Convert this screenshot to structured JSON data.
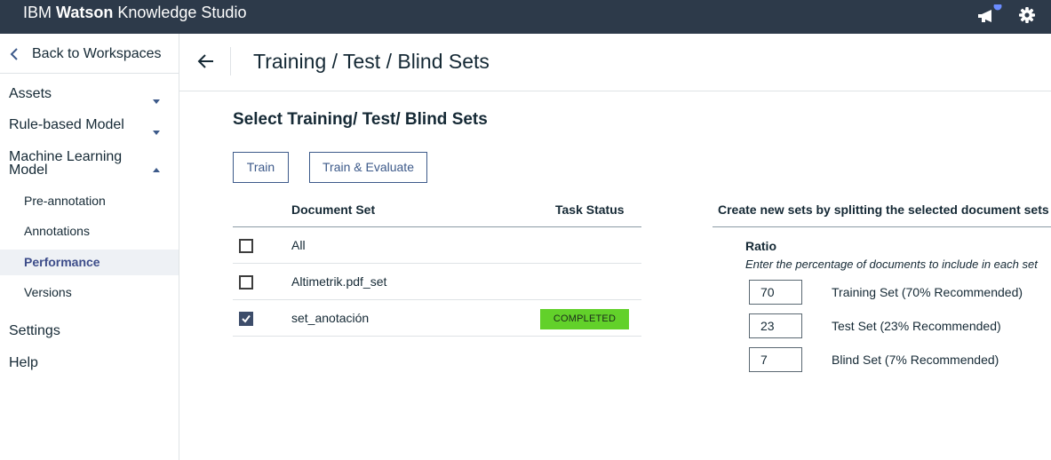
{
  "app": {
    "brand_prefix": "IBM ",
    "brand_bold": "Watson",
    "brand_suffix": " Knowledge Studio"
  },
  "header_icons": [
    "megaphone-icon",
    "gear-icon"
  ],
  "colors": {
    "topbar": "#2d3a4a",
    "accent": "#3d5a8a",
    "notification_dot": "#6b8cff",
    "completed": "#62d12a",
    "active_nav_bg": "#eef1f5"
  },
  "sidebar": {
    "back_label": "Back to Workspaces",
    "sections": [
      {
        "label": "Assets",
        "expanded": false
      },
      {
        "label": "Rule-based Model",
        "expanded": false
      },
      {
        "label": "Machine Learning Model",
        "expanded": true
      }
    ],
    "ml_items": [
      {
        "label": "Pre-annotation",
        "active": false
      },
      {
        "label": "Annotations",
        "active": false
      },
      {
        "label": "Performance",
        "active": true
      },
      {
        "label": "Versions",
        "active": false
      }
    ],
    "settings_label": "Settings",
    "help_label": "Help"
  },
  "page": {
    "title": "Training / Test / Blind Sets",
    "subtitle": "Select Training/ Test/ Blind Sets",
    "train_button": "Train",
    "train_evaluate_button": "Train & Evaluate"
  },
  "table": {
    "columns": [
      "Document Set",
      "Task Status"
    ],
    "rows": [
      {
        "name": "All",
        "checked": false,
        "status": ""
      },
      {
        "name": "Altimetrik.pdf_set",
        "checked": false,
        "status": ""
      },
      {
        "name": "set_anotación",
        "checked": true,
        "status": "COMPLETED"
      }
    ]
  },
  "split": {
    "heading": "Create new sets by splitting the selected document sets",
    "ratio_label": "Ratio",
    "ratio_note": "Enter the percentage of documents to include in each set",
    "sets": [
      {
        "value": "70",
        "label": "Training Set  (70% Recommended)"
      },
      {
        "value": "23",
        "label": "Test Set  (23% Recommended)"
      },
      {
        "value": "7",
        "label": "Blind Set  (7% Recommended)"
      }
    ]
  }
}
